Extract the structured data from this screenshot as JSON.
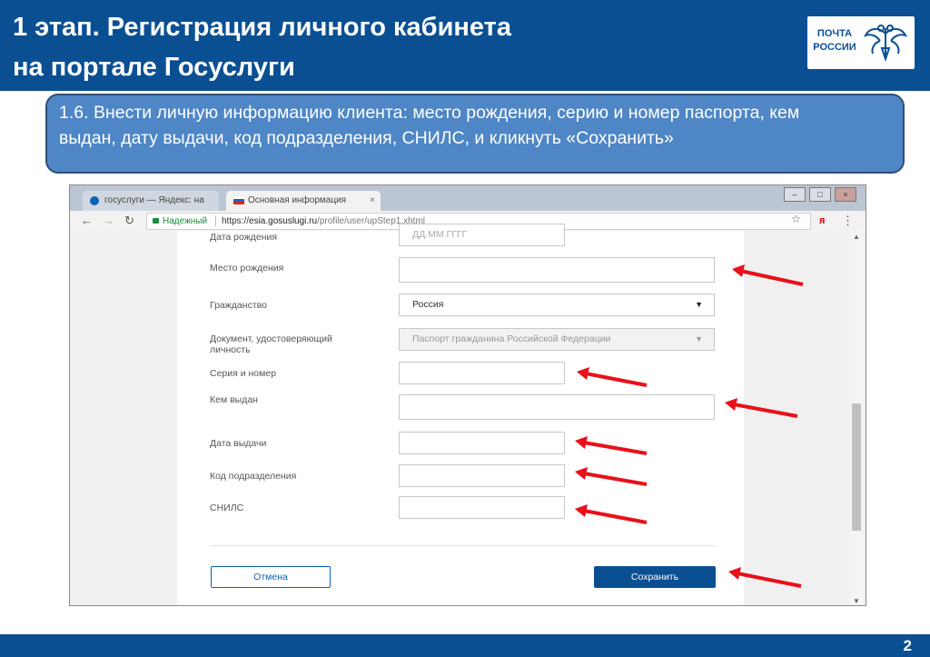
{
  "slide": {
    "title_line1": "1 этап. Регистрация личного кабинета",
    "title_line2": "на портале Госуслуги",
    "logo_line1": "ПОЧТА",
    "logo_line2": "РОССИИ",
    "instruction": "1.6. Внести личную информацию клиента: место рождения, серию и номер паспорта, кем выдан, дату выдачи, код подразделения, СНИЛС, и кликнуть «Сохранить»",
    "page_number": "2",
    "colors": {
      "brand_blue": "#0b4f93",
      "callout_blue": "#4e86c6",
      "arrow_red": "#e8101a"
    }
  },
  "browser": {
    "tabs": [
      {
        "label": "госуслуги — Яндекс: на",
        "icon": "yandex-favicon"
      },
      {
        "label": "Основная информация",
        "icon": "russia-flag-icon"
      }
    ],
    "secure_label": "Надежный",
    "url_scheme": "https://",
    "url_domain": "esia.gosuslugi.ru",
    "url_path": "/profile/user/upStep1.xhtml"
  },
  "form": {
    "birth_date": {
      "label": "Дата рождения",
      "placeholder": "ДД.ММ.ГГГГ"
    },
    "birth_place": {
      "label": "Место рождения",
      "value": ""
    },
    "citizenship": {
      "label": "Гражданство",
      "value": "Россия"
    },
    "document": {
      "label_line1": "Документ, удостоверяющий",
      "label_line2": "личность",
      "value": "Паспорт гражданина Российской Федерации"
    },
    "series_number": {
      "label": "Серия и номер",
      "value": ""
    },
    "issued_by": {
      "label": "Кем выдан",
      "value": ""
    },
    "issue_date": {
      "label": "Дата выдачи",
      "value": ""
    },
    "division_code": {
      "label": "Код подразделения",
      "value": ""
    },
    "snils": {
      "label": "СНИЛС",
      "value": ""
    },
    "cancel_label": "Отмена",
    "save_label": "Сохранить"
  }
}
